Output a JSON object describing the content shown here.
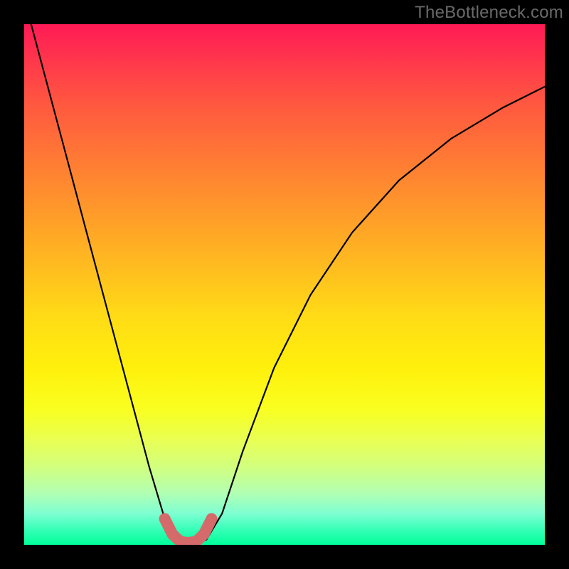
{
  "watermark": "TheBottleneck.com",
  "chart_data": {
    "type": "line",
    "title": "",
    "xlabel": "",
    "ylabel": "",
    "xlim": [
      0,
      100
    ],
    "ylim": [
      0,
      100
    ],
    "series": [
      {
        "name": "curve",
        "x": [
          0,
          4,
          8,
          12,
          16,
          20,
          24,
          27,
          29,
          31,
          33,
          35,
          38,
          42,
          48,
          55,
          63,
          72,
          82,
          92,
          100
        ],
        "y": [
          105,
          90,
          75,
          60,
          45,
          30,
          15,
          5,
          1,
          0,
          0,
          1,
          6,
          18,
          34,
          48,
          60,
          70,
          78,
          84,
          88
        ]
      }
    ],
    "highlight": {
      "name": "bottom-band",
      "x": [
        27.0,
        28.5,
        30.0,
        31.5,
        33.0,
        34.5,
        36.0
      ],
      "y": [
        5.0,
        2.0,
        0.6,
        0.4,
        0.6,
        2.0,
        5.0
      ]
    }
  }
}
